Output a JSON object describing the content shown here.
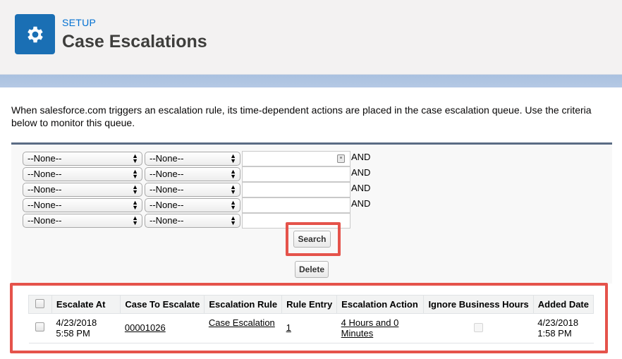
{
  "header": {
    "breadcrumb": "SETUP",
    "title": "Case Escalations",
    "icon": "gear-icon",
    "accent": "#1a6fb4"
  },
  "intro": "When salesforce.com triggers an escalation rule, its time-dependent actions are placed in the case escalation queue. Use the criteria below to monitor this queue.",
  "filters": {
    "rows": [
      {
        "field": "--None--",
        "operator": "--None--",
        "value": "",
        "connector": "AND"
      },
      {
        "field": "--None--",
        "operator": "--None--",
        "value": "",
        "connector": "AND"
      },
      {
        "field": "--None--",
        "operator": "--None--",
        "value": "",
        "connector": "AND"
      },
      {
        "field": "--None--",
        "operator": "--None--",
        "value": "",
        "connector": "AND"
      },
      {
        "field": "--None--",
        "operator": "--None--",
        "value": "",
        "connector": ""
      }
    ],
    "search_label": "Search",
    "delete_label": "Delete"
  },
  "table": {
    "headers": [
      "Escalate At",
      "Case To Escalate",
      "Escalation Rule",
      "Rule Entry",
      "Escalation Action",
      "Ignore Business Hours",
      "Added Date"
    ],
    "rows": [
      {
        "escalate_at": "4/23/2018 5:58 PM",
        "case": "00001026",
        "rule": "Case Escalation",
        "entry": "1",
        "action": "4 Hours and 0 Minutes",
        "ignore_business_hours": false,
        "added": "4/23/2018 1:58 PM"
      }
    ]
  },
  "highlight_color": "#e5534b"
}
